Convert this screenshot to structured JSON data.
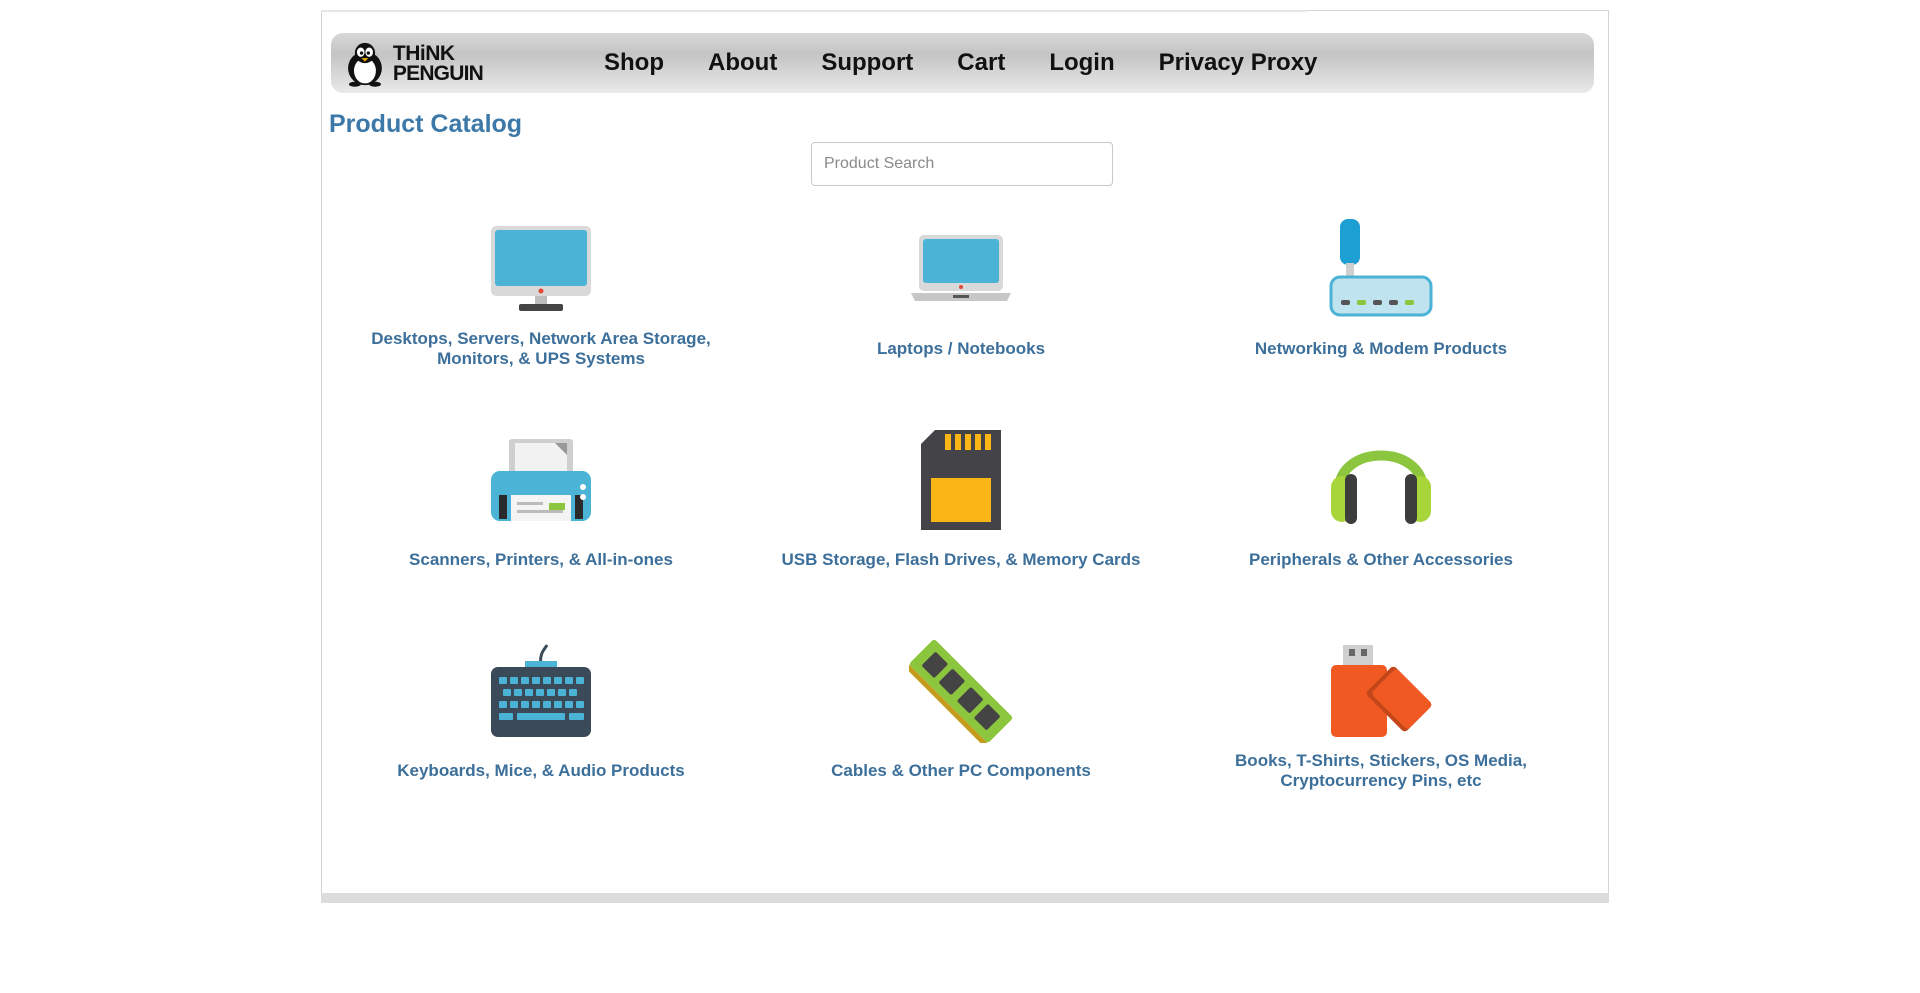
{
  "nav": {
    "logo_line1": "THiNK",
    "logo_line2": "PENGUIN",
    "links": [
      "Shop",
      "About",
      "Support",
      "Cart",
      "Login",
      "Privacy Proxy"
    ]
  },
  "page": {
    "title": "Product Catalog",
    "search_placeholder": "Product Search"
  },
  "categories": [
    {
      "label": "Desktops, Servers, Network Area Storage, Monitors, & UPS Systems",
      "icon": "monitor-icon"
    },
    {
      "label": "Laptops / Notebooks",
      "icon": "laptop-icon"
    },
    {
      "label": "Networking & Modem Products",
      "icon": "router-icon"
    },
    {
      "label": "Scanners, Printers, & All-in-ones",
      "icon": "printer-icon"
    },
    {
      "label": "USB Storage, Flash Drives, & Memory Cards",
      "icon": "sd-card-icon"
    },
    {
      "label": "Peripherals & Other Accessories",
      "icon": "headphones-icon"
    },
    {
      "label": "Keyboards, Mice, & Audio Products",
      "icon": "keyboard-icon"
    },
    {
      "label": "Cables & Other PC Components",
      "icon": "ram-module-icon"
    },
    {
      "label": "Books, T-Shirts, Stickers, OS Media, Cryptocurrency Pins, etc",
      "icon": "usb-drive-icon"
    }
  ],
  "colors": {
    "link": "#3c6f9a",
    "title": "#3c79a8",
    "accent_blue": "#4ab3d6",
    "accent_green": "#8cc63f",
    "accent_orange": "#f05a22"
  }
}
